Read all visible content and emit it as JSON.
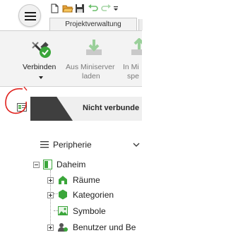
{
  "header": {
    "ribbon_tab": "Projektverwaltung"
  },
  "ribbon": {
    "connect": {
      "label": "Verbinden"
    },
    "load": {
      "label_line1": "Aus Miniserver",
      "label_line2": "laden"
    },
    "save": {
      "label_line1": "In Mi",
      "label_line2": "spe"
    }
  },
  "status": {
    "text": "Nicht verbunde"
  },
  "periphery": {
    "title": "Peripherie"
  },
  "tree": {
    "root": "Daheim",
    "children": [
      "Räume",
      "Kategorien",
      "Symbole",
      "Benutzer und Be"
    ]
  },
  "colors": {
    "annotation": "#e0201c",
    "connect_green": "#3aa63a",
    "status_dark": "#3f3f3f",
    "tree_green": "#3aa63a"
  }
}
